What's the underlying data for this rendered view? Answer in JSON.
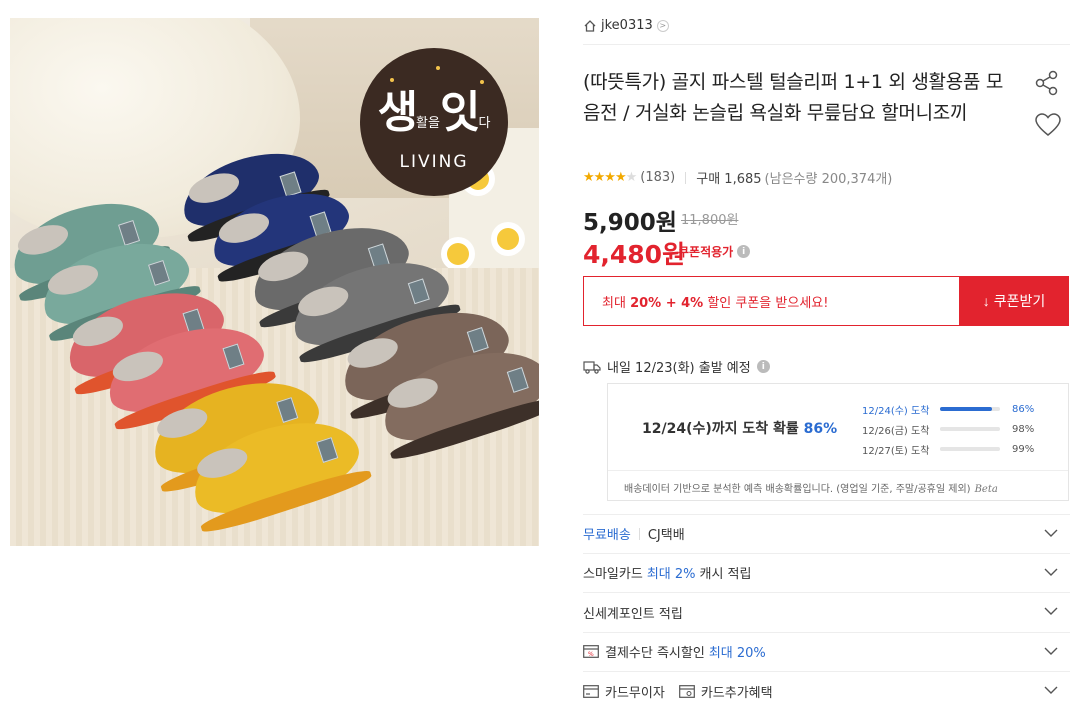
{
  "seller": {
    "name": "jke0313",
    "arrow": ">"
  },
  "product": {
    "title": "(따뜻특가) 골지 파스텔 털슬리퍼 1+1 외 생활용품 모음전 / 거실화 논슬립 욕실화 무릎담요 할머니조끼",
    "image_logo": {
      "line1_big": "생",
      "line1_small1": "활을",
      "line1_big2": "잇",
      "line1_small2": "다",
      "line2": "LIVING"
    }
  },
  "rating": {
    "stars": 4,
    "count": "(183)",
    "buy_label": "구매 1,685",
    "remaining": "(남은수량 200,374개)"
  },
  "price": {
    "sale": "5,900원",
    "original": "11,800원",
    "coupon_price": "4,480원",
    "coupon_label": "쿠폰적용가",
    "info": "i"
  },
  "coupon": {
    "pre": "최대 ",
    "bold1": "20% + 4%",
    "post": " 할인 쿠폰을 받으세요!",
    "button": "쿠폰받기",
    "button_icon": "↓"
  },
  "delivery": {
    "text": "내일 12/23(화) 출발 예정",
    "info": "i",
    "probability": {
      "main_prefix": "12/24(수)까지 도착 확률 ",
      "main_pct": "86%",
      "rows": [
        {
          "date": "12/24(수) 도착",
          "pct": "86%",
          "value": 0.86
        },
        {
          "date": "12/26(금) 도착",
          "pct": "98%",
          "value": 0.98
        },
        {
          "date": "12/27(토) 도착",
          "pct": "99%",
          "value": 0.99
        }
      ],
      "note": "배송데이터 기반으로 분석한 예측 배송확률입니다. (영업일 기준, 주말/공휴일 제외)",
      "beta": "Beta"
    }
  },
  "benefits": {
    "shipping_free": "무료배송",
    "shipping_company": "CJ택배",
    "smilecard_pre": "스마일카드 ",
    "smilecard_highlight": "최대 2%",
    "smilecard_post": " 캐시 적립",
    "ssg_point": "신세계포인트 적립",
    "instant_pre": "결제수단 즉시할인 ",
    "instant_highlight": "최대 20%",
    "card_interest": "카드무이자",
    "card_extra": "카드추가혜택"
  },
  "colors": {
    "accent_red": "#e2232e",
    "accent_blue": "#2b6cd1",
    "star": "#f2a900"
  }
}
